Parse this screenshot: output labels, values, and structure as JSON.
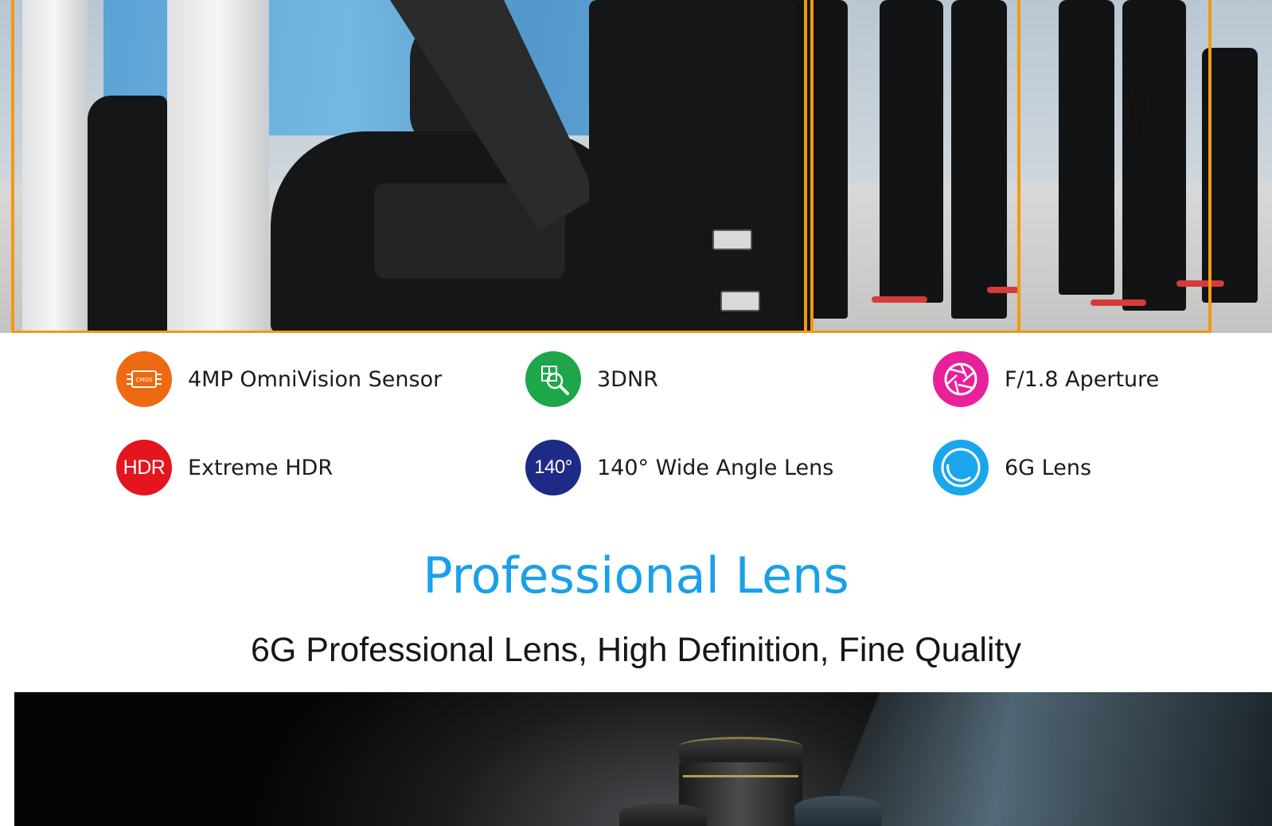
{
  "features": [
    {
      "label": "4MP OmniVision Sensor",
      "icon": "chip-icon",
      "color": "#ee6a12",
      "badge_text": ""
    },
    {
      "label": "3DNR",
      "icon": "magnify-grid-icon",
      "color": "#1ea64a",
      "badge_text": ""
    },
    {
      "label": "F/1.8 Aperture",
      "icon": "aperture-icon",
      "color": "#e8209a",
      "badge_text": ""
    },
    {
      "label": "Extreme HDR",
      "icon": "hdr-icon",
      "color": "#e3151f",
      "badge_text": "HDR"
    },
    {
      "label": "140° Wide Angle Lens",
      "icon": "wide-angle-icon",
      "color": "#1d2a86",
      "badge_text": "140°"
    },
    {
      "label": "6G Lens",
      "icon": "lens-icon",
      "color": "#1aa6ea",
      "badge_text": ""
    }
  ],
  "headline": {
    "title": "Professional Lens",
    "subtitle": "6G Professional Lens, High Definition, Fine Quality",
    "title_color": "#1aa0e8"
  },
  "colors": {
    "frame": "#f19a11"
  }
}
